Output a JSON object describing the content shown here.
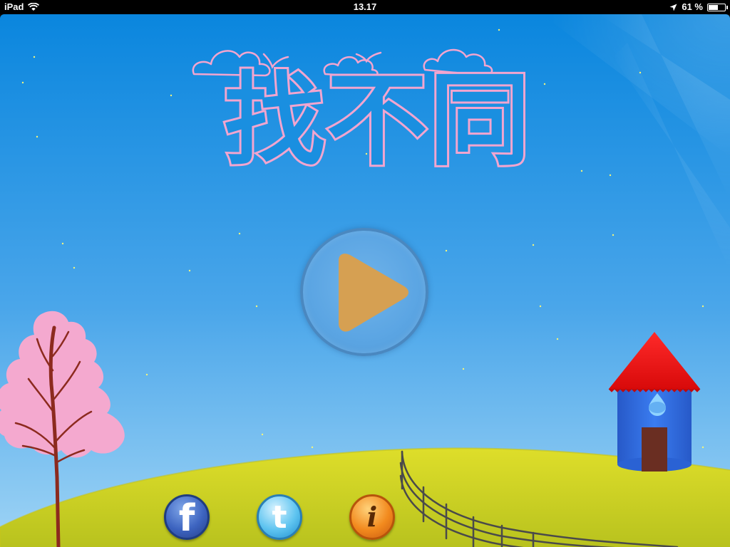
{
  "status_bar": {
    "device": "iPad",
    "time": "13.17",
    "battery": "61 %",
    "battery_level": 0.61
  },
  "game": {
    "title": "找不同",
    "buttons": {
      "play_icon": "play-icon",
      "facebook_glyph": "f",
      "twitter_glyph": "t",
      "info_glyph": "i"
    }
  },
  "colors": {
    "sky_top": "#0a86de",
    "sky_bottom": "#9fd4f5",
    "title_fill": "#1a8fe0",
    "title_outline": "#f2a5cf",
    "play_triangle": "#d6a052",
    "hill": "#d8d82a",
    "house_roof": "#ee1010",
    "house_body": "#2f6fe0",
    "door": "#6a2e22",
    "tree_blossom": "#f4a9cf"
  }
}
